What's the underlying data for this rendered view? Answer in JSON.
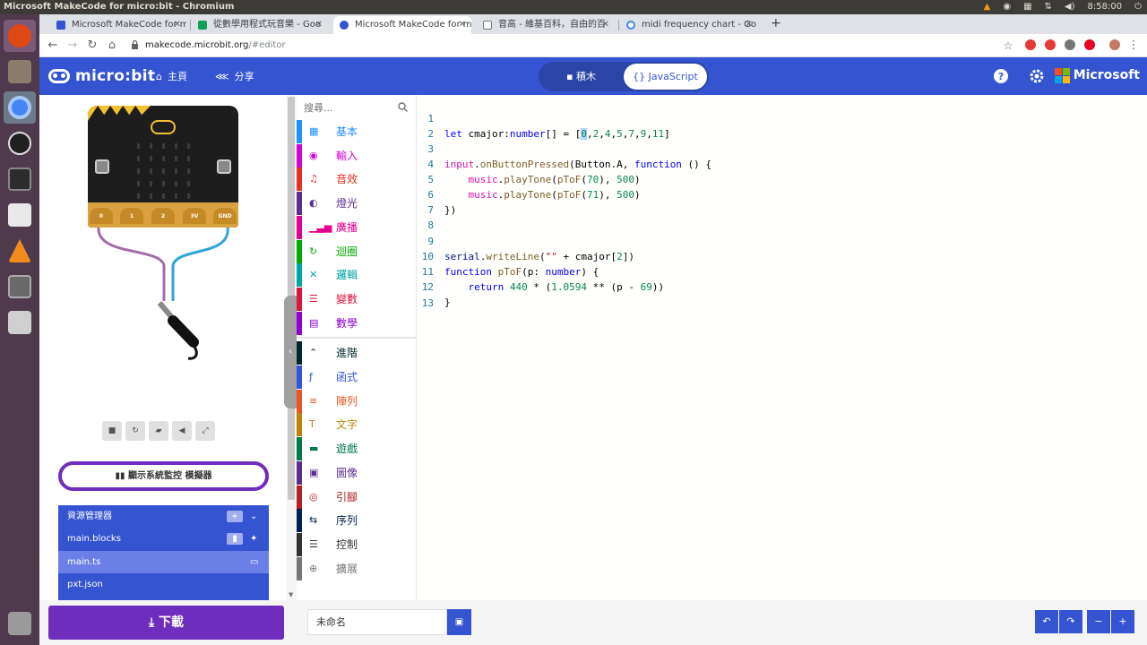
{
  "os": {
    "window_title": "Microsoft MakeCode for micro:bit - Chromium",
    "clock": "8:58:00"
  },
  "tabs": [
    {
      "label": "Microsoft MakeCode for m",
      "active": false
    },
    {
      "label": "從數學用程式玩音樂 - Goo",
      "active": false
    },
    {
      "label": "Microsoft MakeCode for m",
      "active": true
    },
    {
      "label": "音高 - 維基百科，自由的百",
      "active": false
    },
    {
      "label": "midi frequency chart - Go",
      "active": false
    }
  ],
  "omnibox": {
    "host": "makecode.microbit.org",
    "path": "/#editor"
  },
  "header": {
    "logo_text": "micro:bit",
    "home_label": "主頁",
    "share_label": "分享",
    "blocks_label": "積木",
    "javascript_label": "{} JavaScript",
    "microsoft_label": "Microsoft"
  },
  "simulator": {
    "pin_labels": [
      "0",
      "1",
      "2",
      "3V",
      "GND"
    ],
    "serial_button_label": "顯示系統監控  模擬器"
  },
  "explorer": {
    "title": "資源管理器",
    "files": [
      "main.blocks",
      "main.ts",
      "pxt.json"
    ]
  },
  "toolbox": {
    "search_placeholder": "搜尋...",
    "categories": [
      {
        "label": "基本",
        "color": "#1e90ff"
      },
      {
        "label": "輸入",
        "color": "#d400d4"
      },
      {
        "label": "音效",
        "color": "#e63022"
      },
      {
        "label": "燈光",
        "color": "#5c2d91"
      },
      {
        "label": "廣播",
        "color": "#e3008c"
      },
      {
        "label": "迴圈",
        "color": "#00aa00"
      },
      {
        "label": "邏輯",
        "color": "#00a4a6"
      },
      {
        "label": "變數",
        "color": "#dc143c"
      },
      {
        "label": "數學",
        "color": "#9400d3"
      },
      {
        "label": "進階",
        "color": "#00272b"
      },
      {
        "label": "函式",
        "color": "#3455db"
      },
      {
        "label": "陣列",
        "color": "#e65722"
      },
      {
        "label": "文字",
        "color": "#b8860b"
      },
      {
        "label": "遊戲",
        "color": "#007a4b"
      },
      {
        "label": "圖像",
        "color": "#5c2d91"
      },
      {
        "label": "引腳",
        "color": "#b22222"
      },
      {
        "label": "序列",
        "color": "#002050"
      },
      {
        "label": "控制",
        "color": "#333333"
      },
      {
        "label": "擴展",
        "color": "#777777"
      }
    ]
  },
  "code": {
    "line_numbers": [
      "1",
      "2",
      "3",
      "4",
      "5",
      "6",
      "7",
      "8",
      "9",
      "10",
      "11",
      "12",
      "13"
    ]
  },
  "bottom": {
    "download_label": "下載",
    "project_name": "未命名"
  },
  "colors": {
    "brand_blue": "#3454d1",
    "download_purple": "#6f2dbd"
  }
}
